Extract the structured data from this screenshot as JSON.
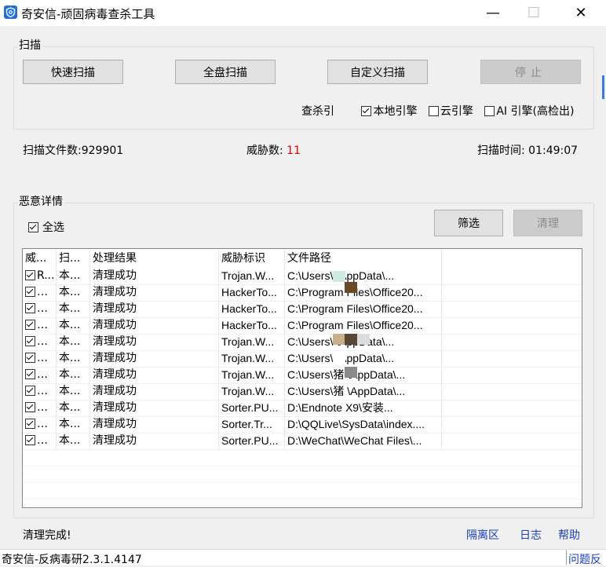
{
  "window": {
    "title": "奇安信-顽固病毒查杀工具",
    "min_glyph": "—",
    "max_glyph": "☐",
    "close_glyph": "✕"
  },
  "scan": {
    "group_label": "扫描",
    "quick": "快速扫描",
    "full": "全盘扫描",
    "custom": "自定义扫描",
    "stop": "停止",
    "engine_label": "查杀引",
    "engines": [
      {
        "label": "本地引擎",
        "checked": true
      },
      {
        "label": "云引擎",
        "checked": false
      },
      {
        "label": "AI 引擎(高检出)",
        "checked": false
      }
    ]
  },
  "stats": {
    "files_label": "扫描文件数:",
    "files_value": "929901",
    "threat_label": "威胁数: ",
    "threat_value": "11",
    "time_label": "扫描时间: ",
    "time_value": "01:49:07"
  },
  "detail": {
    "group_label": "恶意详情",
    "select_all": "全选",
    "filter": "筛选",
    "clean": "清理"
  },
  "table": {
    "headers": [
      "威...",
      "扫...",
      "处理结果",
      "威胁标识",
      "文件路径"
    ],
    "rows": [
      {
        "c0": "R...",
        "c1": "本...",
        "result": "清理成功",
        "threat": "Trojan.W...",
        "path": "C:\\Users\\    \\AppData\\..."
      },
      {
        "c0": "文...",
        "c1": "本...",
        "result": "清理成功",
        "threat": "HackerTo...",
        "path": "C:\\Program Files\\Office20..."
      },
      {
        "c0": "文...",
        "c1": "本...",
        "result": "清理成功",
        "threat": "HackerTo...",
        "path": "C:\\Program Files\\Office20..."
      },
      {
        "c0": "文...",
        "c1": "本...",
        "result": "清理成功",
        "threat": "HackerTo...",
        "path": "C:\\Program Files\\Office20..."
      },
      {
        "c0": "文...",
        "c1": "本...",
        "result": "清理成功",
        "threat": "Trojan.W...",
        "path": "C:\\Users\\    \\AppData\\..."
      },
      {
        "c0": "文...",
        "c1": "本...",
        "result": "清理成功",
        "threat": "Trojan.W...",
        "path": "C:\\Users\\    \\AppData\\..."
      },
      {
        "c0": "文...",
        "c1": "本...",
        "result": "清理成功",
        "threat": "Trojan.W...",
        "path": "C:\\Users\\猪   \\AppData\\..."
      },
      {
        "c0": "文...",
        "c1": "本...",
        "result": "清理成功",
        "threat": "Trojan.W...",
        "path": "C:\\Users\\猪   \\AppData\\..."
      },
      {
        "c0": "文...",
        "c1": "本...",
        "result": "清理成功",
        "threat": "Sorter.PU...",
        "path": "D:\\Endnote   X9\\安装..."
      },
      {
        "c0": "文...",
        "c1": "本...",
        "result": "清理成功",
        "threat": "Sorter.Tr...",
        "path": "D:\\QQLive\\SysData\\index...."
      },
      {
        "c0": "文...",
        "c1": "本...",
        "result": "清理成功",
        "threat": "Sorter.PU...",
        "path": "D:\\WeChat\\WeChat Files\\..."
      }
    ]
  },
  "footer": {
    "status": "清理完成!",
    "quarantine": "隔离区",
    "log": "日志",
    "help": "帮助",
    "bottom_text": "奇安信-反病毒研2.3.1.4147",
    "bottom_right": "问题反"
  }
}
